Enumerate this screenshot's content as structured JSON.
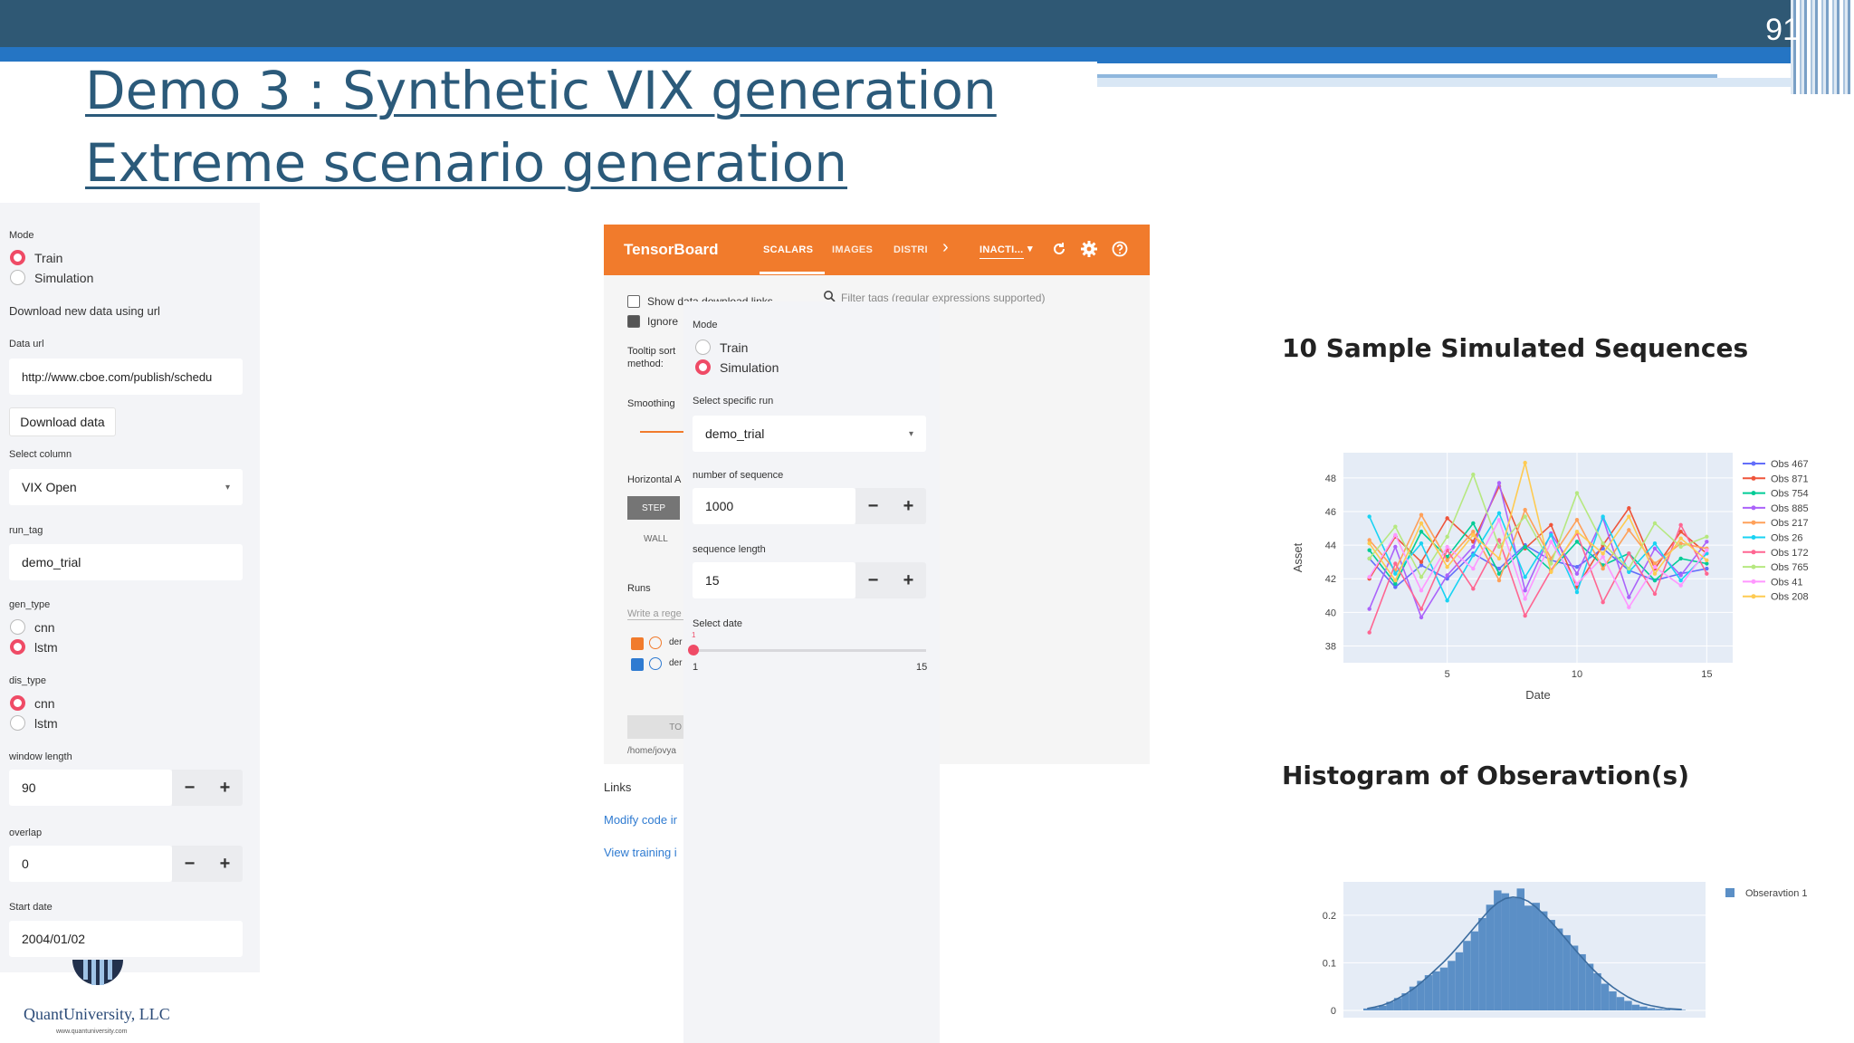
{
  "slide": {
    "number": "91",
    "title_line1": "Demo 3 : Synthetic VIX generation",
    "title_line2": "Extreme scenario generation"
  },
  "left_panel": {
    "mode_label": "Mode",
    "mode_options": [
      "Train",
      "Simulation"
    ],
    "mode_selected": "Train",
    "download_heading": "Download new data using url",
    "data_url_label": "Data url",
    "data_url_value": "http://www.cboe.com/publish/schedu",
    "download_button": "Download data",
    "select_column_label": "Select column",
    "select_column_value": "VIX Open",
    "run_tag_label": "run_tag",
    "run_tag_value": "demo_trial",
    "gen_type_label": "gen_type",
    "gen_type_options": [
      "cnn",
      "lstm"
    ],
    "gen_type_selected": "lstm",
    "dis_type_label": "dis_type",
    "dis_type_options": [
      "cnn",
      "lstm"
    ],
    "dis_type_selected": "cnn",
    "window_length_label": "window length",
    "window_length_value": "90",
    "overlap_label": "overlap",
    "overlap_value": "0",
    "start_date_label": "Start date",
    "start_date_value": "2004/01/02",
    "minus": "−",
    "plus": "+"
  },
  "tensorboard": {
    "logo": "TensorBoard",
    "tabs": [
      "SCALARS",
      "IMAGES",
      "DISTRI"
    ],
    "more": "›",
    "inactive": "INACTI...",
    "show_download": "Show data download links",
    "ignore": "Ignore",
    "filter": "Filter tags (regular expressions supported)",
    "tooltip_sort_1": "Tooltip sort",
    "tooltip_sort_2": "method:",
    "smoothing": "Smoothing",
    "horizontal": "Horizontal A",
    "step": "STEP",
    "wall": "WALL",
    "runs": "Runs",
    "write_regex": "Write a rege",
    "run1": "der",
    "run2": "der",
    "toggle": "TO",
    "path": "/home/jovya",
    "links": "Links",
    "modify": "Modify code ir",
    "view_training": "View training i"
  },
  "overlay_panel": {
    "mode_label": "Mode",
    "mode_options": [
      "Train",
      "Simulation"
    ],
    "mode_selected": "Simulation",
    "run_label": "Select specific run",
    "run_value": "demo_trial",
    "num_seq_label": "number of sequence",
    "num_seq_value": "1000",
    "seq_len_label": "sequence length",
    "seq_len_value": "15",
    "date_label": "Select date",
    "slider_value": "1",
    "slider_min": "1",
    "slider_max": "15"
  },
  "charts": {
    "line_title": "10 Sample Simulated Sequences",
    "hist_title": "Histogram of Obseravtion(s)"
  },
  "chart_data": [
    {
      "type": "line",
      "title": "10 Sample Simulated Sequences",
      "xlabel": "Date",
      "ylabel": "Asset",
      "xticks": [
        "5",
        "10",
        "15"
      ],
      "yticks": [
        "38",
        "40",
        "42",
        "44",
        "46",
        "48"
      ],
      "xlim": [
        1,
        16
      ],
      "ylim": [
        37,
        49.5
      ],
      "x": [
        2,
        3,
        4,
        5,
        6,
        7,
        8,
        9,
        10,
        11,
        12,
        13,
        14,
        15
      ],
      "series": [
        {
          "name": "Obs 467",
          "color": "#636efa",
          "values": [
            43.2,
            41.5,
            42.8,
            42,
            43.5,
            42.6,
            44,
            43.1,
            42.7,
            43.8,
            42.5,
            41.9,
            42.3,
            42.6
          ]
        },
        {
          "name": "Obs 871",
          "color": "#ef553b",
          "values": [
            42,
            44.5,
            43,
            45.6,
            44.2,
            47.5,
            43.8,
            45.2,
            41.5,
            44,
            46.2,
            42.6,
            44.8,
            43.5
          ]
        },
        {
          "name": "Obs 754",
          "color": "#00cc96",
          "values": [
            43.7,
            41.7,
            44.8,
            43.3,
            45.3,
            42.3,
            43.9,
            42.5,
            44.2,
            42.8,
            43.5,
            41.9,
            43.2,
            42.9
          ]
        },
        {
          "name": "Obs 885",
          "color": "#ab63fa",
          "values": [
            40.2,
            43.9,
            39.7,
            42.2,
            43.9,
            47.7,
            41.3,
            44.7,
            42.3,
            45.6,
            40.9,
            43.8,
            42.2,
            44.2
          ]
        },
        {
          "name": "Obs 217",
          "color": "#ffa15a",
          "values": [
            44.3,
            42.5,
            45.8,
            43.1,
            44.8,
            41.9,
            46.1,
            43.2,
            45.5,
            42.6,
            44.9,
            42.9,
            44.1,
            43.8
          ]
        },
        {
          "name": "Obs 26",
          "color": "#19d3f3",
          "values": [
            45.7,
            42.3,
            44.1,
            40.7,
            43.4,
            45.9,
            42.1,
            44.6,
            41.2,
            45.7,
            42.4,
            44.1,
            41.9,
            43.5
          ]
        },
        {
          "name": "Obs 172",
          "color": "#ff6692",
          "values": [
            38.8,
            42.9,
            40.2,
            43.7,
            41.4,
            44.3,
            39.8,
            42.5,
            44.7,
            40.6,
            43.5,
            41.1,
            45.2,
            42.3
          ]
        },
        {
          "name": "Obs 765",
          "color": "#b6e880",
          "values": [
            43.2,
            45.1,
            42.1,
            44.5,
            48.2,
            43.9,
            45.7,
            42.9,
            47.1,
            44.1,
            42.6,
            45.3,
            43.9,
            44.5
          ]
        },
        {
          "name": "Obs 41",
          "color": "#ff97ff",
          "values": [
            42.1,
            44.6,
            41.3,
            43.9,
            42.6,
            45.5,
            40.8,
            44.2,
            41.7,
            43.3,
            40.3,
            42.7,
            41.6,
            43.7
          ]
        },
        {
          "name": "Obs 208",
          "color": "#fecb52",
          "values": [
            44.1,
            41.9,
            45.3,
            42.7,
            44.6,
            43.2,
            48.9,
            42.4,
            44.8,
            43.5,
            45.7,
            42.3,
            44.4,
            43.1
          ]
        }
      ],
      "legend": "right"
    },
    {
      "type": "bar",
      "title": "Histogram of Obseravtion(s)",
      "yticks": [
        "0",
        "0.1",
        "0.2"
      ],
      "ylim": [
        0,
        0.27
      ],
      "legend_entry": "Obseravtion 1",
      "color": "#5b8fc6",
      "values": [
        0.004,
        0.006,
        0.01,
        0.018,
        0.026,
        0.036,
        0.05,
        0.062,
        0.074,
        0.082,
        0.09,
        0.104,
        0.122,
        0.146,
        0.166,
        0.194,
        0.222,
        0.252,
        0.246,
        0.236,
        0.256,
        0.22,
        0.226,
        0.208,
        0.19,
        0.172,
        0.158,
        0.136,
        0.118,
        0.098,
        0.078,
        0.056,
        0.04,
        0.028,
        0.02,
        0.012,
        0.008,
        0.005,
        0.003,
        0.002,
        0.001,
        0.001
      ],
      "density": [
        0.004,
        0.007,
        0.011,
        0.017,
        0.025,
        0.034,
        0.045,
        0.058,
        0.072,
        0.087,
        0.102,
        0.119,
        0.137,
        0.156,
        0.175,
        0.194,
        0.212,
        0.226,
        0.235,
        0.238,
        0.236,
        0.229,
        0.217,
        0.202,
        0.185,
        0.167,
        0.148,
        0.129,
        0.111,
        0.093,
        0.077,
        0.062,
        0.049,
        0.038,
        0.028,
        0.02,
        0.014,
        0.01,
        0.007,
        0.004,
        0.003,
        0.002
      ]
    }
  ],
  "logo": {
    "name": "QuantUniversity, LLC",
    "url": "www.quantuniversity.com"
  }
}
